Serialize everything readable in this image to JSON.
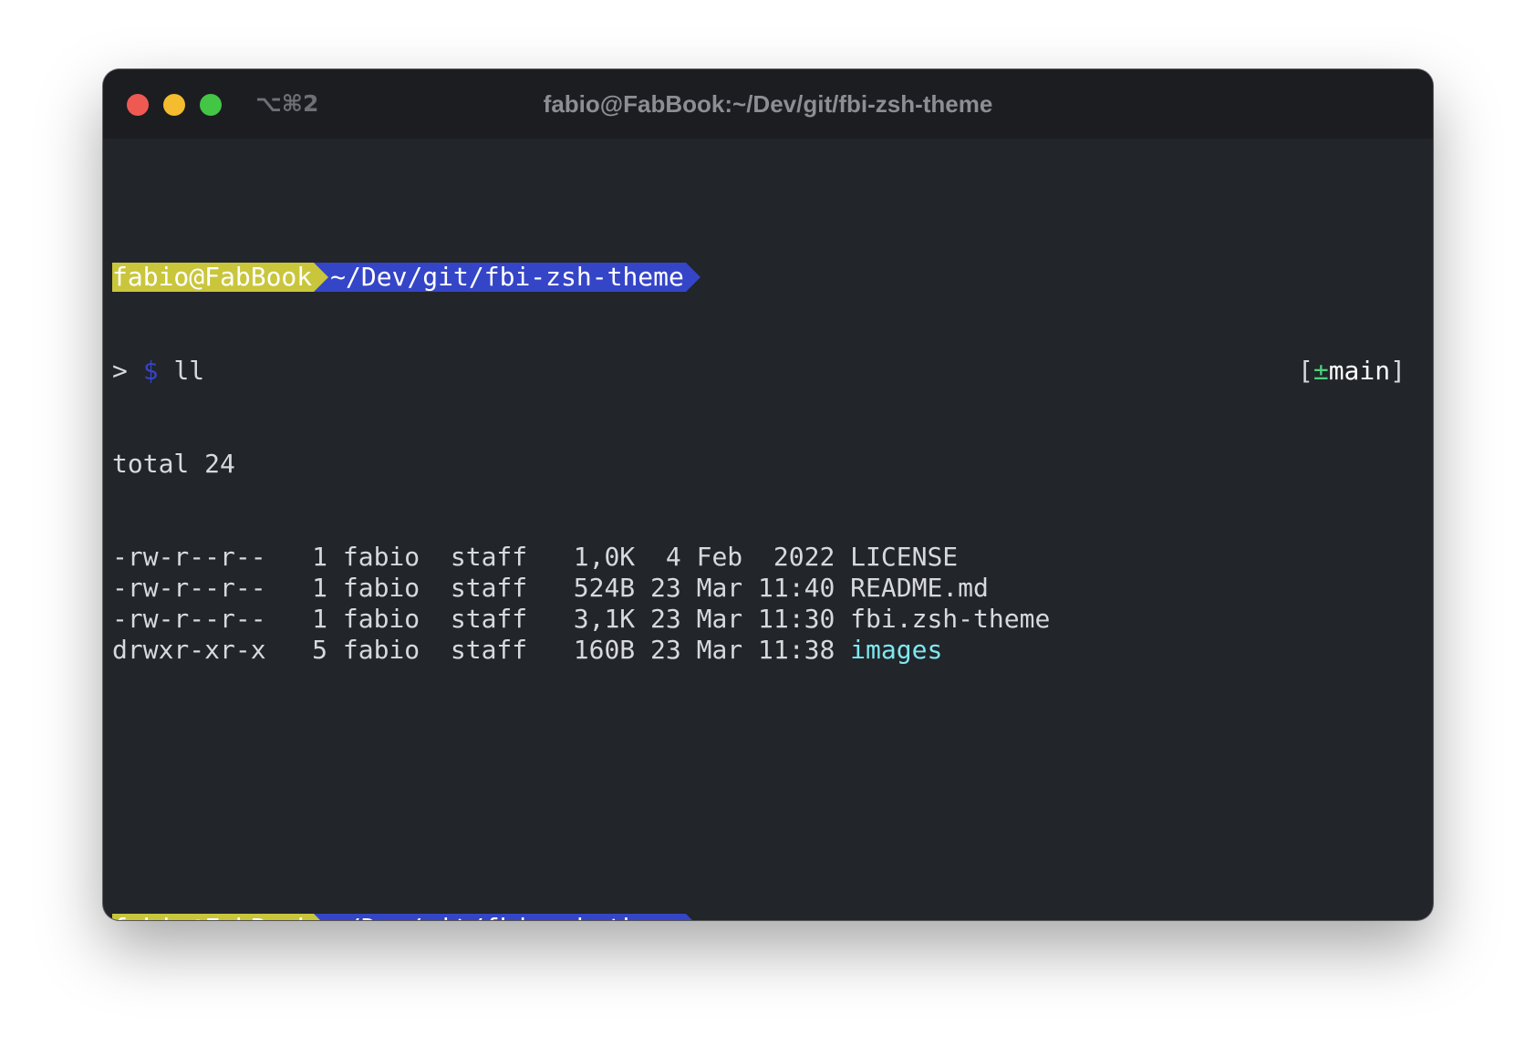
{
  "window": {
    "shortcut": "⌥⌘2",
    "title": "fabio@FabBook:~/Dev/git/fbi-zsh-theme"
  },
  "prompt": {
    "user_host": "fabio@FabBook",
    "path": "~/Dev/git/fbi-zsh-theme",
    "caret": ">",
    "dollar": "$",
    "git_open": "[",
    "git_plus": "±",
    "git_branch": "main",
    "git_close": "]"
  },
  "session": {
    "command": "ll",
    "total": "total 24",
    "listing": [
      {
        "perms": "-rw-r--r--",
        "links": "1",
        "owner": "fabio",
        "group": "staff",
        "size": "1,0K",
        "date": " 4 Feb  2022",
        "name": "LICENSE",
        "is_dir": false
      },
      {
        "perms": "-rw-r--r--",
        "links": "1",
        "owner": "fabio",
        "group": "staff",
        "size": "524B",
        "date": "23 Mar 11:40",
        "name": "README.md",
        "is_dir": false
      },
      {
        "perms": "-rw-r--r--",
        "links": "1",
        "owner": "fabio",
        "group": "staff",
        "size": "3,1K",
        "date": "23 Mar 11:30",
        "name": "fbi.zsh-theme",
        "is_dir": false
      },
      {
        "perms": "drwxr-xr-x",
        "links": "5",
        "owner": "fabio",
        "group": "staff",
        "size": "160B",
        "date": "23 Mar 11:38",
        "name": "images",
        "is_dir": true
      }
    ]
  },
  "colors": {
    "user_segment": "#c9c63c",
    "path_segment": "#3545c8",
    "dollar": "#3545c8",
    "git_plus": "#4fd07a",
    "directory": "#7ee8f0",
    "background": "#22252a",
    "titlebar": "#1b1d21"
  }
}
